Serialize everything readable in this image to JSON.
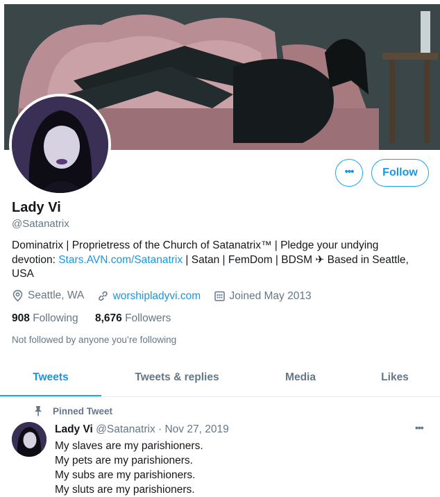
{
  "profile": {
    "name": "Lady Vi",
    "handle": "@Satanatrix",
    "bio_line1": "Dominatrix | Proprietress of the Church of Satanatrix™ | Pledge your undying",
    "bio_line2_pre": "devotion: ",
    "bio_link": "Stars.AVN.com/Satanatrix",
    "bio_line2_post": " | Satan | FemDom | BDSM ✈ Based in Seattle,",
    "bio_line3": "USA",
    "location": "Seattle, WA",
    "website": "worshipladyvi.com",
    "joined": "Joined May 2013",
    "following_count": "908",
    "following_label": "Following",
    "followers_count": "8,676",
    "followers_label": "Followers",
    "not_followed": "Not followed by anyone you’re following"
  },
  "actions": {
    "more_label": "•••",
    "follow_label": "Follow"
  },
  "tabs": [
    {
      "label": "Tweets",
      "active": true
    },
    {
      "label": "Tweets & replies",
      "active": false
    },
    {
      "label": "Media",
      "active": false
    },
    {
      "label": "Likes",
      "active": false
    }
  ],
  "pinned_tweet": {
    "pinned_label": "Pinned Tweet",
    "author_name": "Lady Vi",
    "author_handle": "@Satanatrix",
    "date": " · Nov 27, 2019",
    "more_label": "•••",
    "lines": [
      "My slaves are my parishioners.",
      "My pets are my parishioners.",
      "My subs are my parishioners.",
      "My sluts are my parishioners."
    ]
  },
  "colors": {
    "accent": "#1da1f2",
    "link": "#1b95e0",
    "secondary_text": "#657786",
    "primary_text": "#14171a"
  }
}
